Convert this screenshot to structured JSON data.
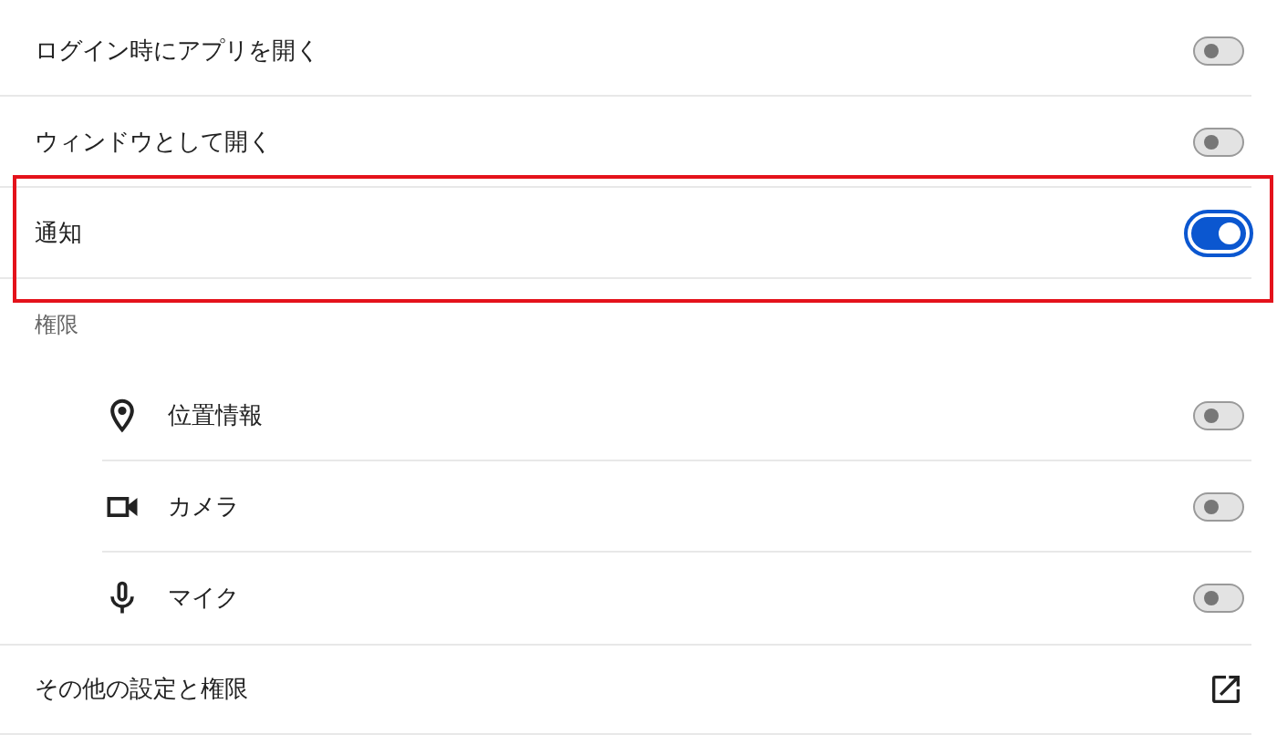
{
  "settings": [
    {
      "label": "ログイン時にアプリを開く",
      "on": false,
      "highlighted": false
    },
    {
      "label": "ウィンドウとして開く",
      "on": false,
      "highlighted": false
    },
    {
      "label": "通知",
      "on": true,
      "highlighted": true
    }
  ],
  "permissions": {
    "heading": "権限",
    "items": [
      {
        "kind": "location",
        "label": "位置情報",
        "on": false
      },
      {
        "kind": "camera",
        "label": "カメラ",
        "on": false
      },
      {
        "kind": "microphone",
        "label": "マイク",
        "on": false
      }
    ]
  },
  "more_link": {
    "label": "その他の設定と権限"
  }
}
